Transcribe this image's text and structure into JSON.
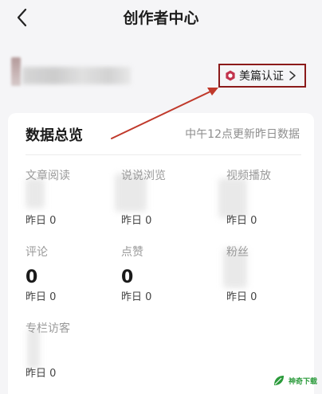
{
  "header": {
    "title": "创作者中心",
    "back_icon": "chevron-left-icon"
  },
  "profile": {
    "certification": {
      "label": "美篇认证",
      "icon": "badge-icon",
      "chevron_icon": "chevron-right-icon",
      "icon_color": "#c2334d"
    }
  },
  "overview": {
    "title": "数据总览",
    "update_note": "中午12点更新昨日数据",
    "stats": [
      {
        "label": "文章阅读",
        "value": "",
        "sub": "昨日 0"
      },
      {
        "label": "说说浏览",
        "value": "",
        "sub": "昨日 0"
      },
      {
        "label": "视频播放",
        "value": "",
        "sub": "昨日 0"
      },
      {
        "label": "评论",
        "value": "0",
        "sub": "昨日 0"
      },
      {
        "label": "点赞",
        "value": "0",
        "sub": "昨日 0"
      },
      {
        "label": "粉丝",
        "value": "",
        "sub": "昨日 0"
      },
      {
        "label": "专栏访客",
        "value": "",
        "sub": "昨日 0"
      }
    ]
  },
  "annotation": {
    "arrow_color": "#c0392b",
    "box_color": "#8b1a1a"
  },
  "watermark": {
    "text": "神奇下载",
    "icon": "leaf-icon",
    "color": "#2a9a3a"
  }
}
